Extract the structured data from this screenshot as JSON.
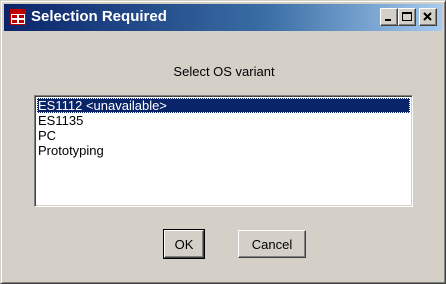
{
  "window": {
    "title": "Selection Required",
    "icon": "app-grid-icon",
    "controls": {
      "minimize": "minimize-icon",
      "maximize": "maximize-icon",
      "close": "close-icon"
    }
  },
  "dialog": {
    "prompt": "Select OS variant",
    "options": [
      {
        "label": "ES1112 <unavailable>",
        "selected": true
      },
      {
        "label": "ES1135",
        "selected": false
      },
      {
        "label": "PC",
        "selected": false
      },
      {
        "label": "Prototyping",
        "selected": false
      }
    ],
    "ok_label": "OK",
    "cancel_label": "Cancel"
  },
  "colors": {
    "titlebar_start": "#0a246a",
    "titlebar_end": "#a6caf0",
    "selection": "#0a246a",
    "face": "#d4d0c8"
  }
}
